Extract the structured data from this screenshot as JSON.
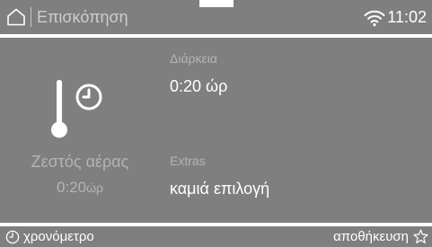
{
  "colors": {
    "panel_background": "#7f7f7f",
    "primary_text": "#ffffff",
    "secondary_text": "#b4b4b4"
  },
  "header": {
    "home_icon": "home-icon",
    "title": "Επισκόπηση",
    "wifi_icon": "wifi-icon",
    "time": "11:02"
  },
  "program": {
    "icon": "thermometer-clock-icon",
    "name": "Ζεστός αέρας",
    "time_value": "0:20",
    "time_unit": "ώρ"
  },
  "details": {
    "duration_label": "Διάρκεια",
    "duration_value": "0:20 ώρ",
    "extras_label": "Extras",
    "extras_value": "καμιά επιλογή"
  },
  "footer": {
    "timer_icon": "clock-icon",
    "timer_label": "χρονόμετρο",
    "save_label": "αποθήκευση",
    "save_icon": "star-icon"
  }
}
